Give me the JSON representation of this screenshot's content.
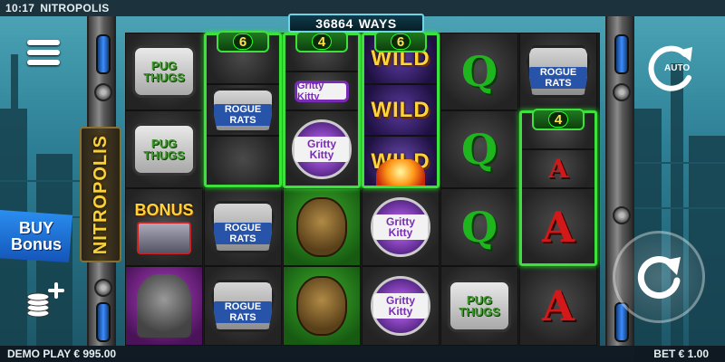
{
  "status_bar": {
    "time": "10:17",
    "game_title": "NITROPOLIS"
  },
  "ways": {
    "count": "36864",
    "label": "WAYS"
  },
  "logo_text": "NITROPOLIS",
  "reel_multipliers": [
    {
      "reel": 2,
      "value": "6"
    },
    {
      "reel": 3,
      "value": "4"
    },
    {
      "reel": 4,
      "value": "6"
    },
    {
      "reel": 6,
      "value": "4"
    }
  ],
  "symbols": {
    "pug": "PUG THUGS",
    "rats": "ROGUE RATS",
    "kitty": "Gritty Kitty",
    "wild": "WILD",
    "bonus": "BONUS",
    "q": "Q",
    "a": "A"
  },
  "left_panel": {
    "buy_bonus_line1": "BUY",
    "buy_bonus_line2": "Bonus"
  },
  "right_panel": {
    "auto_label": "AUTO"
  },
  "bottom_bar": {
    "balance": "DEMO PLAY € 995.00",
    "bet": "BET € 1.00"
  },
  "icons": [
    "menu-icon",
    "coins-add-icon",
    "autoplay-icon",
    "spin-icon"
  ]
}
